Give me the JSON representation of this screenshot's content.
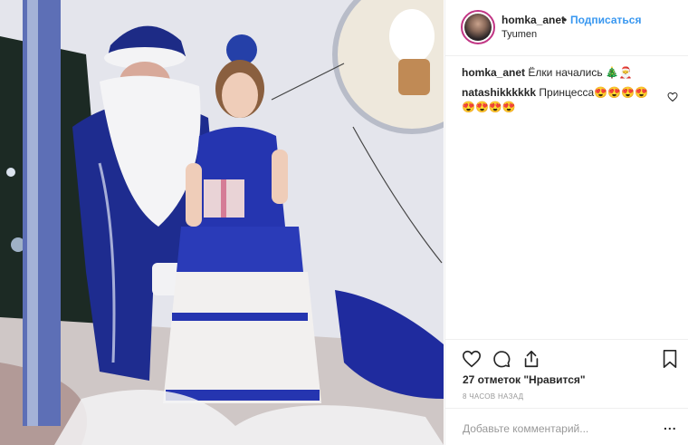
{
  "photo": {
    "subject": "photo"
  },
  "header": {
    "username": "homka_anet",
    "separator": "•",
    "follow_label": "Подписаться",
    "location": "Tyumen"
  },
  "comments": [
    {
      "user": "homka_anet",
      "text": "Ёлки начались 🎄🎅"
    },
    {
      "user": "natashikkkkkk",
      "text": "Принцесса😍😍😍😍😍😍😍😍"
    }
  ],
  "actions": {
    "like_icon": "heart-icon",
    "comment_icon": "comment-icon",
    "share_icon": "share-icon",
    "save_icon": "bookmark-icon"
  },
  "likes_text": "27 отметок \"Нравится\"",
  "time_text": "8 часов назад",
  "add_comment_placeholder": "Добавьте комментарий...",
  "more_label": "...",
  "colors": {
    "follow": "#3897f0",
    "avatar_ring": "#c13584",
    "costume_blue": "#1f2fa3"
  }
}
